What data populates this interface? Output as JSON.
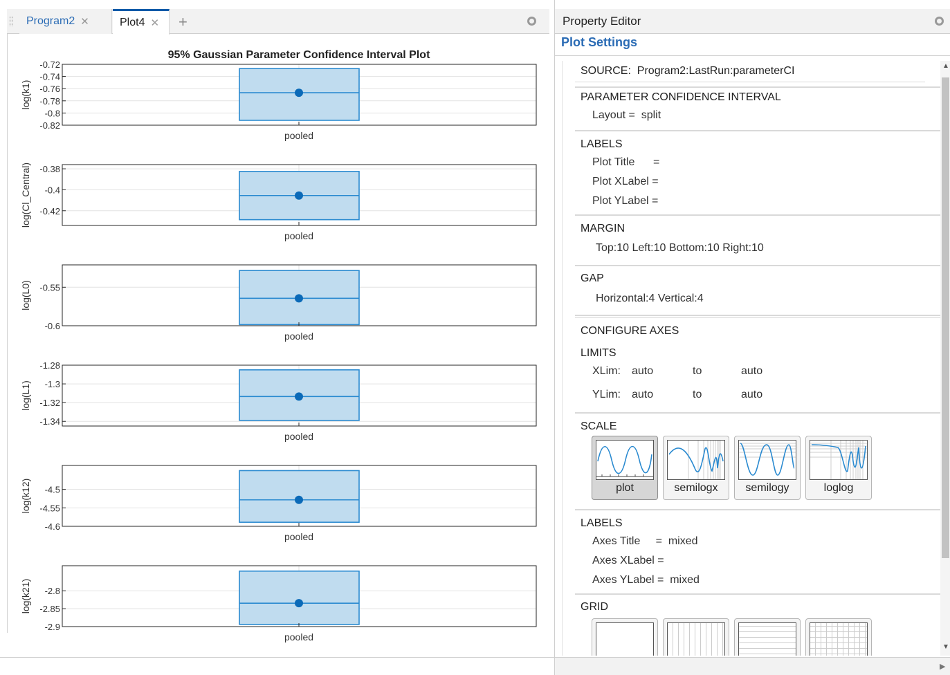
{
  "tabs": [
    {
      "label": "Program2",
      "active": false
    },
    {
      "label": "Plot4",
      "active": true
    }
  ],
  "chart_data": {
    "type": "box",
    "title": "95% Gaussian Parameter Confidence Interval Plot",
    "subplots": [
      {
        "ylabel": "log(k1)",
        "yticks": [
          "-0.72",
          "-0.74",
          "-0.76",
          "-0.78",
          "-0.8",
          "-0.82"
        ],
        "ylim": [
          -0.82,
          -0.72
        ],
        "category": "pooled",
        "lower": -0.812,
        "upper": -0.727,
        "estimate": -0.7667
      },
      {
        "ylabel": "log(Cl_Central)",
        "yticks": [
          "-0.38",
          "-0.4",
          "-0.42"
        ],
        "ylim": [
          -0.434,
          -0.376
        ],
        "category": "pooled",
        "lower": -0.4285,
        "upper": -0.3825,
        "estimate": -0.4055
      },
      {
        "ylabel": "log(L0)",
        "yticks": [
          "-0.55",
          "-0.6"
        ],
        "ylim": [
          -0.6,
          -0.521
        ],
        "category": "pooled",
        "lower": -0.5985,
        "upper": -0.5283,
        "estimate": -0.5644
      },
      {
        "ylabel": "log(L1)",
        "yticks": [
          "-1.28",
          "-1.3",
          "-1.32",
          "-1.34"
        ],
        "ylim": [
          -1.345,
          -1.28
        ],
        "category": "pooled",
        "lower": -1.339,
        "upper": -1.285,
        "estimate": -1.3135
      },
      {
        "ylabel": "log(k12)",
        "yticks": [
          "-4.5",
          "-4.55",
          "-4.6"
        ],
        "ylim": [
          -4.6,
          -4.435
        ],
        "category": "pooled",
        "lower": -4.589,
        "upper": -4.449,
        "estimate": -4.5283
      },
      {
        "ylabel": "log(k21)",
        "yticks": [
          "-2.8",
          "-2.85",
          "-2.9"
        ],
        "ylim": [
          -2.9,
          -2.73
        ],
        "category": "pooled",
        "lower": -2.894,
        "upper": -2.745,
        "estimate": -2.8346
      }
    ],
    "colors": {
      "fill": "#c0dcef",
      "edge": "#2a8ad0",
      "marker": "#0b6ab8"
    }
  },
  "editor": {
    "title": "Property Editor",
    "section_title": "Plot Settings",
    "source": "SOURCE:  Program2:LastRun:parameterCI",
    "pci_heading": "PARAMETER CONFIDENCE INTERVAL",
    "layout": "Layout =  split",
    "labels_heading": "LABELS",
    "plot_title": "Plot Title      =",
    "plot_xlabel": "Plot XLabel =",
    "plot_ylabel": "Plot YLabel =",
    "margin_heading": "MARGIN",
    "margin_value": "Top:10 Left:10 Bottom:10 Right:10",
    "gap_heading": "GAP",
    "gap_value": "Horizontal:4 Vertical:4",
    "configure_heading": "CONFIGURE AXES",
    "limits_heading": "LIMITS",
    "xlim_label": "XLim:",
    "xlim_min": "auto",
    "xlim_to": "to",
    "xlim_max": "auto",
    "ylim_label": "YLim:",
    "ylim_min": "auto",
    "ylim_to": "to",
    "ylim_max": "auto",
    "scale_heading": "SCALE",
    "scale_options": [
      "plot",
      "semilogx",
      "semilogy",
      "loglog"
    ],
    "scale_selected": "plot",
    "labels2_heading": "LABELS",
    "axes_title": "Axes Title     =  mixed",
    "axes_xlabel": "Axes XLabel =",
    "axes_ylabel": "Axes YLabel =  mixed",
    "grid_heading": "GRID"
  }
}
